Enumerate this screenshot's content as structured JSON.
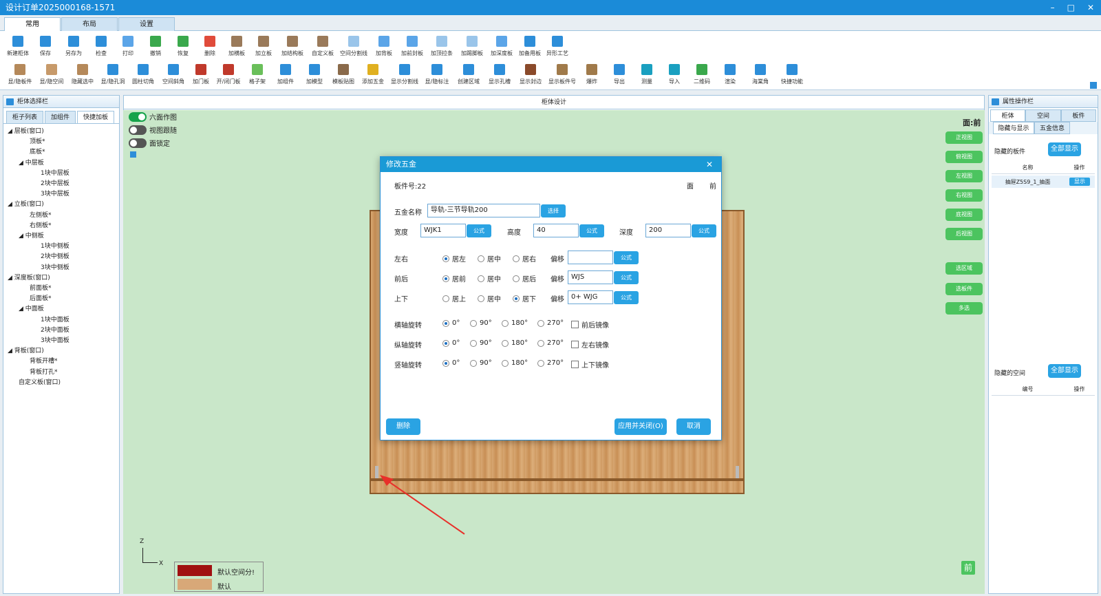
{
  "window": {
    "title": "设计订单2025000168-1571",
    "controls": [
      "–",
      "□",
      "✕"
    ]
  },
  "tabs": [
    "常用",
    "布局",
    "设置"
  ],
  "ribbon_row1": [
    {
      "label": "新建柜体",
      "color": "#2d8ed9"
    },
    {
      "label": "保存",
      "color": "#2d8ed9"
    },
    {
      "label": "另存为",
      "color": "#2d8ed9"
    },
    {
      "label": "检查",
      "color": "#2d8ed9"
    },
    {
      "label": "打印",
      "color": "#5ba5e8"
    },
    {
      "label": "撤销",
      "color": "#3aa84c"
    },
    {
      "label": "恢复",
      "color": "#3aa84c"
    },
    {
      "label": "删除",
      "color": "#e04b3b"
    },
    {
      "label": "加横板",
      "color": "#9a7a5a"
    },
    {
      "label": "加立板",
      "color": "#9a7a5a"
    },
    {
      "label": "加结构板",
      "color": "#9a7a5a"
    },
    {
      "label": "自定义板",
      "color": "#9a7a5a"
    },
    {
      "label": "空间分割线",
      "color": "#9ac5ea"
    },
    {
      "label": "加背板",
      "color": "#5ba5e8"
    },
    {
      "label": "加前封板",
      "color": "#5ba5e8"
    },
    {
      "label": "加顶拉条",
      "color": "#9ac5ea"
    },
    {
      "label": "加踢脚板",
      "color": "#9ac5ea"
    },
    {
      "label": "加深度板",
      "color": "#5ba5e8"
    },
    {
      "label": "加备用板",
      "color": "#2d8ed9"
    },
    {
      "label": "异形工艺",
      "color": "#2d8ed9"
    }
  ],
  "ribbon_row2": [
    {
      "label": "显/隐板件",
      "color": "#b5895a"
    },
    {
      "label": "显/隐空间",
      "color": "#c79a6a"
    },
    {
      "label": "隐藏选中",
      "color": "#b5895a"
    },
    {
      "label": "显/隐孔洞",
      "color": "#2d8ed9"
    },
    {
      "label": "圆柱切角",
      "color": "#2d8ed9"
    },
    {
      "label": "空间斜角",
      "color": "#2d8ed9"
    },
    {
      "label": "加门板",
      "color": "#c0392b"
    },
    {
      "label": "开/闭门板",
      "color": "#c0392b"
    },
    {
      "label": "格子架",
      "color": "#6abf5a"
    },
    {
      "label": "加组件",
      "color": "#2d8ed9"
    },
    {
      "label": "加模型",
      "color": "#2d8ed9"
    },
    {
      "label": "模板贴图",
      "color": "#8a6a4a"
    },
    {
      "label": "添加五金",
      "color": "#e0b020"
    },
    {
      "label": "显示分割线",
      "color": "#2d8ed9"
    },
    {
      "label": "显/隐标注",
      "color": "#2d8ed9"
    },
    {
      "label": "创建区域",
      "color": "#2d8ed9"
    },
    {
      "label": "显示孔槽",
      "color": "#2d8ed9"
    },
    {
      "label": "显示封边",
      "color": "#8a4a2a"
    },
    {
      "label": "显示板件号",
      "color": "#a07a4a"
    },
    {
      "label": "爆炸",
      "color": "#a07a4a"
    },
    {
      "label": "导出",
      "color": "#2d8ed9"
    },
    {
      "label": "测量",
      "color": "#1aa0c0"
    },
    {
      "label": "导入",
      "color": "#1aa0c0"
    },
    {
      "label": "二维码",
      "color": "#3aa84c"
    },
    {
      "label": "渲染",
      "color": "#2d8ed9"
    },
    {
      "label": "海棠角",
      "color": "#2d8ed9"
    },
    {
      "label": "快捷功能",
      "color": "#2d8ed9"
    }
  ],
  "left_panel": {
    "title": "柜体选择栏",
    "tabs": [
      "柜子列表",
      "加组件",
      "快捷加板"
    ],
    "tree": [
      {
        "t": "◢ 层板(窗口)",
        "lv": 0
      },
      {
        "t": "顶板*",
        "lv": 2
      },
      {
        "t": "底板*",
        "lv": 2
      },
      {
        "t": "◢ 中层板",
        "lv": 1
      },
      {
        "t": "1块中层板",
        "lv": 3
      },
      {
        "t": "2块中层板",
        "lv": 3
      },
      {
        "t": "3块中层板",
        "lv": 3
      },
      {
        "t": "◢ 立板(窗口)",
        "lv": 0
      },
      {
        "t": "左侧板*",
        "lv": 2
      },
      {
        "t": "右侧板*",
        "lv": 2
      },
      {
        "t": "◢ 中侧板",
        "lv": 1
      },
      {
        "t": "1块中侧板",
        "lv": 3
      },
      {
        "t": "2块中侧板",
        "lv": 3
      },
      {
        "t": "3块中侧板",
        "lv": 3
      },
      {
        "t": "◢ 深度板(窗口)",
        "lv": 0
      },
      {
        "t": "前面板*",
        "lv": 2
      },
      {
        "t": "后面板*",
        "lv": 2
      },
      {
        "t": "◢ 中面板",
        "lv": 1
      },
      {
        "t": "1块中面板",
        "lv": 3
      },
      {
        "t": "2块中面板",
        "lv": 3
      },
      {
        "t": "3块中面板",
        "lv": 3
      },
      {
        "t": "◢ 背板(窗口)",
        "lv": 0
      },
      {
        "t": "背板开槽*",
        "lv": 2
      },
      {
        "t": "背板打孔*",
        "lv": 2
      },
      {
        "t": "自定义板(窗口)",
        "lv": 1
      }
    ]
  },
  "center": {
    "title": "柜体设计",
    "toggles": [
      {
        "label": "六面作图",
        "on": true
      },
      {
        "label": "视图跟随",
        "on": false
      },
      {
        "label": "面锁定",
        "on": false
      }
    ],
    "face_label": "面:前",
    "view_buttons": [
      "正视图",
      "俯视图",
      "左视图",
      "右视图",
      "底视图",
      "后视图"
    ],
    "select_buttons": [
      "选区域",
      "选板件",
      "多选"
    ],
    "axis": {
      "z": "Z",
      "x": "X"
    },
    "legend": [
      {
        "label": "默认空间分!",
        "color": "#a01010"
      },
      {
        "label": "默认",
        "color": "#d8a878"
      }
    ],
    "front_badge": "前"
  },
  "dialog": {
    "title": "修改五金",
    "part_no": "板件号:22",
    "face_label": "面",
    "face_value": "前",
    "name_label": "五金名称",
    "name_value": "导轨-三节导轨200",
    "select_btn": "选择",
    "width_label": "宽度",
    "width_value": "WJK1",
    "height_label": "高度",
    "height_value": "40",
    "depth_label": "深度",
    "depth_value": "200",
    "formula_btn": "公式",
    "offset_label": "偏移",
    "lr": {
      "label": "左右",
      "options": [
        "居左",
        "居中",
        "居右"
      ],
      "selected": 0,
      "offset": ""
    },
    "fb": {
      "label": "前后",
      "options": [
        "居前",
        "居中",
        "居后"
      ],
      "selected": 0,
      "offset": "WJS"
    },
    "ud": {
      "label": "上下",
      "options": [
        "居上",
        "居中",
        "居下"
      ],
      "selected": 2,
      "offset": "0+ WJG"
    },
    "rotations": [
      {
        "label": "横轴旋转",
        "options": [
          "0°",
          "90°",
          "180°",
          "270°"
        ],
        "selected": 0,
        "mirror": "前后镜像"
      },
      {
        "label": "纵轴旋转",
        "options": [
          "0°",
          "90°",
          "180°",
          "270°"
        ],
        "selected": 0,
        "mirror": "左右镜像"
      },
      {
        "label": "竖轴旋转",
        "options": [
          "0°",
          "90°",
          "180°",
          "270°"
        ],
        "selected": 0,
        "mirror": "上下镜像"
      }
    ],
    "delete_btn": "删除",
    "apply_btn": "应用并关闭(O)",
    "cancel_btn": "取消"
  },
  "right_panel": {
    "title": "属性操作栏",
    "tabs": [
      "柜体",
      "空间",
      "板件"
    ],
    "subtabs": [
      "隐藏与显示",
      "五金信息"
    ],
    "hidden_parts_label": "隐藏的板件",
    "show_all": "全部显示",
    "col_name": "名称",
    "col_op": "操作",
    "row_name": "抽屉Z5S9_1_抽面",
    "row_btn": "显示",
    "hidden_space_label": "隐藏的空间",
    "col_no": "编号"
  }
}
